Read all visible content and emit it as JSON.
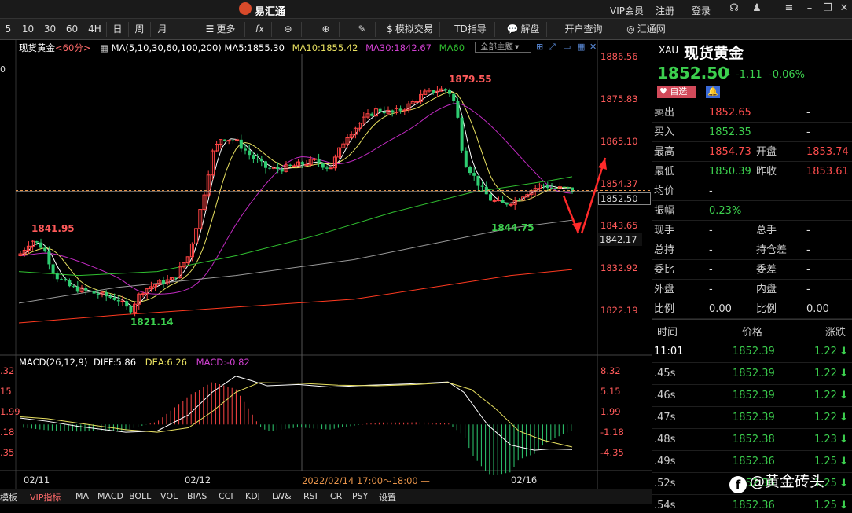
{
  "app": {
    "title": "易汇通",
    "links": [
      "VIP会员",
      "注册",
      "登录"
    ]
  },
  "toolbar": {
    "periods": [
      "5",
      "10",
      "30",
      "60",
      "4H",
      "日",
      "周",
      "月"
    ],
    "more": "更多",
    "fx": "fx",
    "sim_trade": "模拟交易",
    "td_guide": "TD指导",
    "analysis": "解盘",
    "account_query": "开户查询",
    "huitong_net": "汇通网"
  },
  "chart_header": {
    "symbol": "现货黄金",
    "period": "<60分>",
    "ma_label": "MA(5,10,30,60,100,200)",
    "ma5": "MA5:1855.30",
    "ma10": "MA10:1855.42",
    "ma30": "MA30:1842.67",
    "ma60": "MA60",
    "theme_button": "全部主题"
  },
  "colors": {
    "up": "#ff4444",
    "down": "#2ecc71",
    "ma5": "#ffffff",
    "ma10": "#e8e060",
    "ma30": "#c02ac0",
    "ma60": "#30c030",
    "ma100": "#9a9a9a",
    "ma200": "#ff3a20",
    "macd_diff": "#ffffff",
    "macd_dea": "#e8e060",
    "macd_hist": "#c02ac0"
  },
  "price_axis": [
    "1886.56",
    "1875.83",
    "1865.10",
    "1854.37",
    "1843.65",
    "1832.92",
    "1822.19"
  ],
  "macd_axis": [
    "8.32",
    "5.15",
    "1.99",
    "-1.18",
    "-4.35"
  ],
  "left_axis": {
    "top": "0",
    "macd": [
      ".32",
      "15",
      "1.99",
      ".18",
      ".35"
    ]
  },
  "current_price_tag": "1852.50",
  "crosshair_price_tag": "1842.17",
  "annotations": {
    "high": "1879.55",
    "left_high": "1841.95",
    "low": "1821.14",
    "recent_low": "1844.75"
  },
  "macd_header": {
    "label": "MACD(26,12,9)",
    "diff": "DIFF:5.86",
    "dea": "DEA:6.26",
    "macd": "MACD:-0.82"
  },
  "x_axis": {
    "d1": "02/11",
    "d2": "02/12",
    "cursor": "2022/02/14 17:00～18:00 —",
    "d3": "02/16"
  },
  "bottom_tabs": [
    "模板",
    "VIP指标",
    "MA",
    "MACD",
    "BOLL",
    "VOL",
    "BIAS",
    "CCI",
    "KDJ",
    "LW&",
    "RSI",
    "CR",
    "PSY",
    "设置"
  ],
  "quote": {
    "code": "XAU",
    "name": "现货黄金",
    "price": "1852.50",
    "change": "-1.11",
    "change_pct": "-0.06%",
    "fav_button": "自选",
    "rows": [
      {
        "l1": "卖出",
        "v1": "1852.65",
        "l2": "",
        "v2": "-"
      },
      {
        "l1": "买入",
        "v1": "1852.35",
        "l2": "",
        "v2": "-"
      },
      {
        "l1": "最高",
        "v1": "1854.73",
        "l2": "开盘",
        "v2": "1853.74"
      },
      {
        "l1": "最低",
        "v1": "1850.39",
        "l2": "昨收",
        "v2": "1853.61"
      },
      {
        "l1": "均价",
        "v1": "-",
        "l2": "",
        "v2": ""
      },
      {
        "l1": "振幅",
        "v1": "0.23%",
        "l2": "",
        "v2": ""
      },
      {
        "l1": "现手",
        "v1": "-",
        "l2": "总手",
        "v2": "-"
      },
      {
        "l1": "总持",
        "v1": "-",
        "l2": "持仓差",
        "v2": "-"
      },
      {
        "l1": "委比",
        "v1": "-",
        "l2": "委差",
        "v2": "-"
      },
      {
        "l1": "外盘",
        "v1": "-",
        "l2": "内盘",
        "v2": "-"
      },
      {
        "l1": "比例",
        "v1": "0.00",
        "l2": "比例",
        "v2": "0.00"
      }
    ],
    "ticks_header": {
      "time": "时间",
      "price": "价格",
      "change": "涨跌"
    },
    "ticks": [
      {
        "time": "11:01",
        "price": "1852.39",
        "change": "1.22"
      },
      {
        "time": ".45s",
        "price": "1852.39",
        "change": "1.22"
      },
      {
        "time": ".46s",
        "price": "1852.39",
        "change": "1.22"
      },
      {
        "time": ".47s",
        "price": "1852.39",
        "change": "1.22"
      },
      {
        "time": ".48s",
        "price": "1852.38",
        "change": "1.23"
      },
      {
        "time": ".49s",
        "price": "1852.36",
        "change": "1.25"
      },
      {
        "time": ".52s",
        "price": "1852.36",
        "change": "1.25"
      },
      {
        "time": ".54s",
        "price": "1852.36",
        "change": "1.25"
      }
    ]
  },
  "watermark": "@黄金砖头"
}
